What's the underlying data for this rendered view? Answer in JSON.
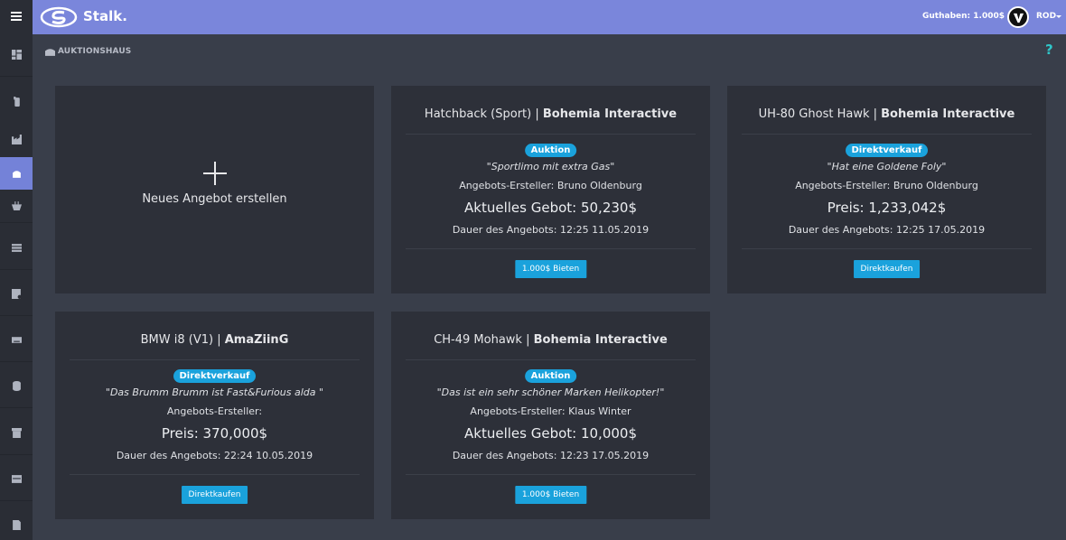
{
  "app": {
    "brand": "Stalk."
  },
  "header": {
    "balance": "Guthaben: 1.000$",
    "user": "ROD"
  },
  "breadcrumb": {
    "label": "AUKTIONSHAUS",
    "help": "?"
  },
  "sidebar": {
    "items": [
      {
        "icon": "dashboard-icon",
        "active": false
      },
      {
        "icon": "phone-icon",
        "active": false
      },
      {
        "icon": "factory-icon",
        "active": false
      },
      {
        "icon": "auction-house-icon",
        "active": true
      },
      {
        "icon": "basket-icon",
        "active": false
      },
      {
        "icon": "list-icon",
        "active": false
      },
      {
        "icon": "document-list-icon",
        "active": false
      },
      {
        "icon": "keyboard-icon",
        "active": false
      },
      {
        "icon": "database-icon",
        "active": false
      },
      {
        "icon": "archive-icon",
        "active": false
      },
      {
        "icon": "window-icon",
        "active": false
      },
      {
        "icon": "file-icon",
        "active": false
      }
    ]
  },
  "new_offer": {
    "label": "Neues Angebot erstellen"
  },
  "offers": [
    {
      "name": "Hatchback (Sport)",
      "seller": "Bohemia Interactive",
      "type": "Auktion",
      "quote": "\"Sportlimo mit extra Gas\"",
      "creator": "Angebots-Ersteller: Bruno Oldenburg",
      "price": "Aktuelles Gebot: 50,230$",
      "duration": "Dauer des Angebots: 12:25 11.05.2019",
      "action": "1.000$ Bieten"
    },
    {
      "name": "UH-80 Ghost Hawk",
      "seller": "Bohemia Interactive",
      "type": "Direktverkauf",
      "quote": "\"Hat eine Goldene Foly\"",
      "creator": "Angebots-Ersteller: Bruno Oldenburg",
      "price": "Preis: 1,233,042$",
      "duration": "Dauer des Angebots: 12:25 17.05.2019",
      "action": "Direktkaufen"
    },
    {
      "name": "BMW i8 (V1)",
      "seller": "AmaZiinG",
      "type": "Direktverkauf",
      "quote": "\"Das Brumm Brumm ist Fast&Furious alda \"",
      "creator": "Angebots-Ersteller:",
      "price": "Preis: 370,000$",
      "duration": "Dauer des Angebots: 22:24 10.05.2019",
      "action": "Direktkaufen"
    },
    {
      "name": "CH-49 Mohawk",
      "seller": "Bohemia Interactive",
      "type": "Auktion",
      "quote": "\"Das ist ein sehr schöner Marken Helikopter!\"",
      "creator": "Angebots-Ersteller: Klaus Winter",
      "price": "Aktuelles Gebot: 10,000$",
      "duration": "Dauer des Angebots: 12:23 17.05.2019",
      "action": "1.000$ Bieten"
    }
  ],
  "colors": {
    "accent": "#7a86db",
    "button": "#1aa2dc",
    "card": "#2d3039",
    "background": "#393e4a",
    "help": "#2fc6c9"
  }
}
